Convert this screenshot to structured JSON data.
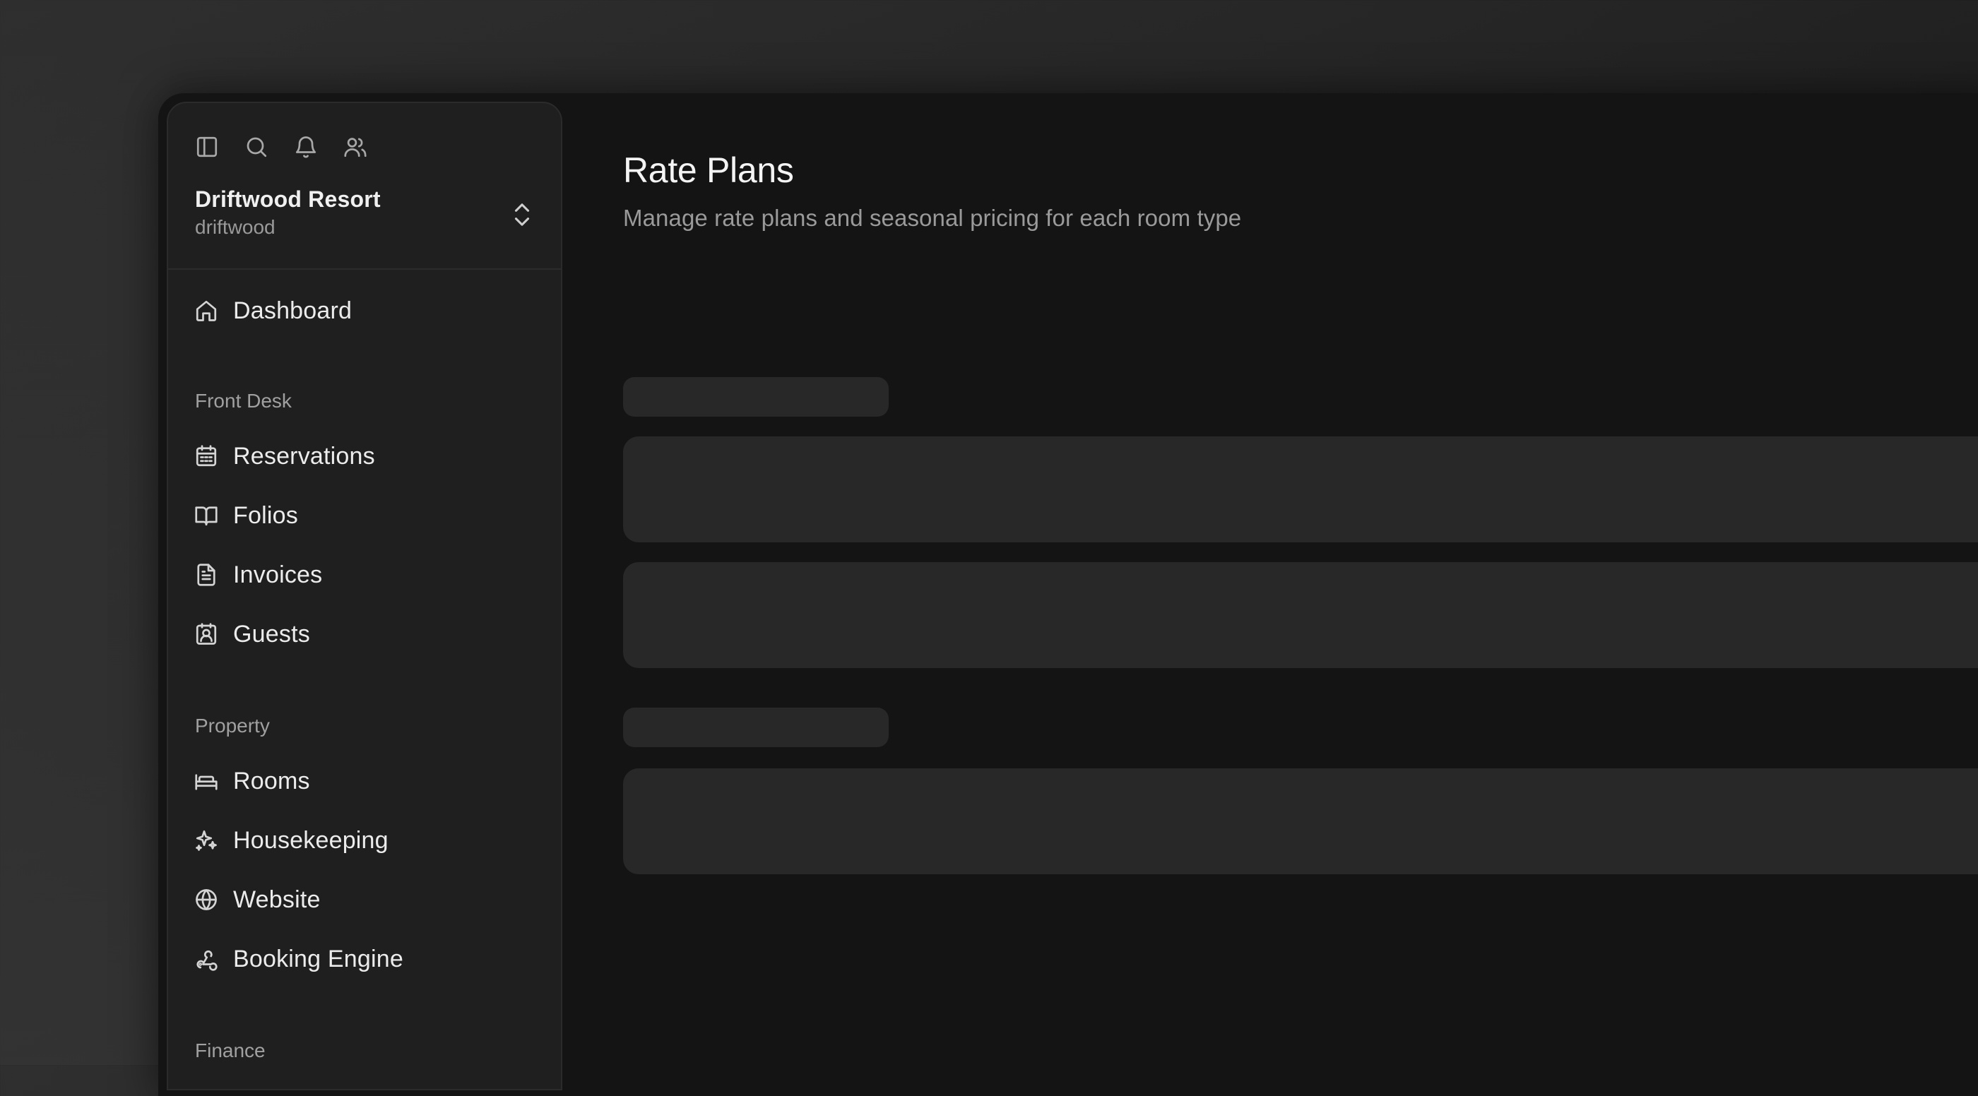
{
  "topbar": {
    "icons": [
      "sidebar-toggle-icon",
      "search-icon",
      "bell-icon",
      "users-icon"
    ]
  },
  "org": {
    "name": "Driftwood Resort",
    "slug": "driftwood"
  },
  "sidebar": {
    "dashboard": {
      "label": "Dashboard",
      "icon": "home-icon"
    },
    "sections": [
      {
        "label": "Front Desk",
        "items": [
          {
            "label": "Reservations",
            "icon": "calendar-icon"
          },
          {
            "label": "Folios",
            "icon": "book-open-icon"
          },
          {
            "label": "Invoices",
            "icon": "file-text-icon"
          },
          {
            "label": "Guests",
            "icon": "contact-icon"
          }
        ]
      },
      {
        "label": "Property",
        "items": [
          {
            "label": "Rooms",
            "icon": "bed-icon"
          },
          {
            "label": "Housekeeping",
            "icon": "sparkles-icon"
          },
          {
            "label": "Website",
            "icon": "globe-icon"
          },
          {
            "label": "Booking Engine",
            "icon": "webhook-icon"
          }
        ]
      },
      {
        "label": "Finance",
        "items": []
      }
    ]
  },
  "main": {
    "title": "Rate Plans",
    "subtitle": "Manage rate plans and seasonal pricing for each room type"
  },
  "colors": {
    "background": "#141414",
    "sidebar": "#1f1f1f",
    "skeleton": "#282828",
    "text_primary": "#f4f4f4",
    "text_muted": "#9a9a9a"
  }
}
